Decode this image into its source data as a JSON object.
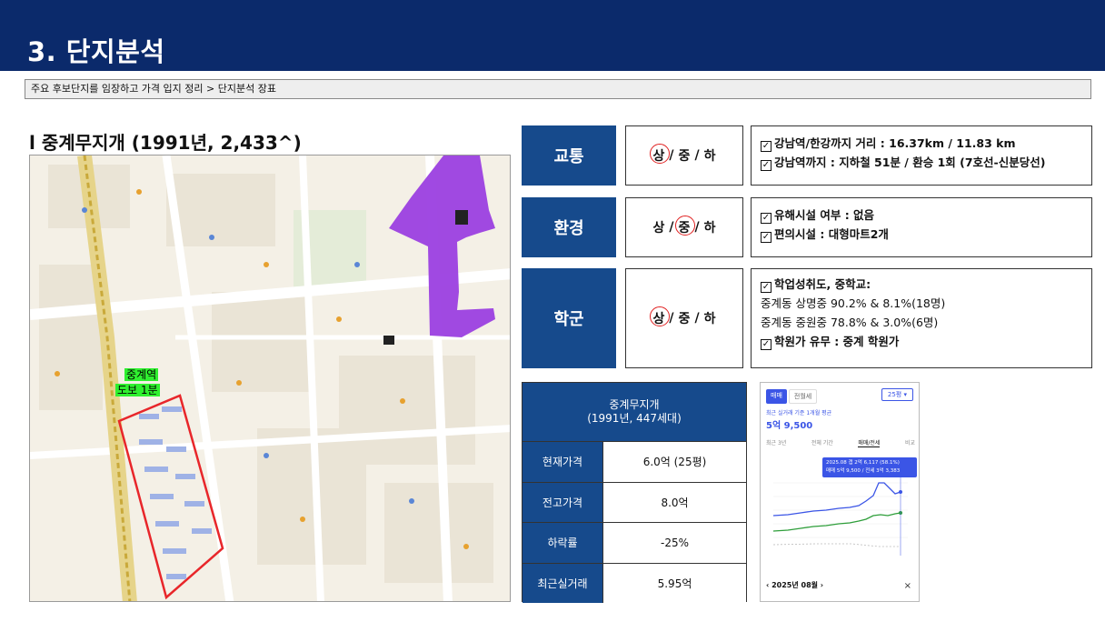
{
  "header": {
    "title": "3. 단지분석"
  },
  "breadcrumb": "주요 후보단지를 임장하고 가격 입지 정리 > 단지분석 장표",
  "complex": {
    "title": "l 중계무지개 (1991년, 2,433^)"
  },
  "map": {
    "station_label_1": "중계역",
    "station_label_2": "도보 1분",
    "colors": {
      "complex_outline": "#e8262a",
      "zone_fill": "#9b3fe0",
      "rail": "#d4b84a"
    }
  },
  "criteria": [
    {
      "category": "교통",
      "grades": [
        "상",
        "중",
        "하"
      ],
      "selected": 0,
      "details": [
        {
          "text": "강남역/한강까지 거리 : 16.37km / 11.83 km",
          "checked": true
        },
        {
          "text": "강남역까지 : 지하철 51분 / 환승 1회 (7호선-신분당선)",
          "checked": true
        }
      ]
    },
    {
      "category": "환경",
      "grades": [
        "상",
        "중",
        "하"
      ],
      "selected": 1,
      "details": [
        {
          "text": "유해시설 여부 : 없음",
          "checked": true
        },
        {
          "text": "편의시설 : 대형마트2개",
          "checked": true
        }
      ]
    },
    {
      "category": "학군",
      "grades": [
        "상",
        "중",
        "하"
      ],
      "selected": 0,
      "details": [
        {
          "text": "학업성취도, 중학교:",
          "checked": true
        },
        {
          "text": "중계동 상명중 90.2% & 8.1%(18명)",
          "checked": false
        },
        {
          "text": "중계동 중원중 78.8% & 3.0%(6명)",
          "checked": false
        },
        {
          "text": "학원가 유무 : 중계 학원가",
          "checked": true
        }
      ]
    }
  ],
  "price_table": {
    "title_line1": "중계무지개",
    "title_line2": "(1991년, 447세대)",
    "rows": [
      {
        "label": "현재가격",
        "value": "6.0억  (25평)"
      },
      {
        "label": "전고가격",
        "value": "8.0억"
      },
      {
        "label": "하락률",
        "value": "-25%"
      },
      {
        "label": "최근실거래",
        "value": "5.95억"
      }
    ]
  },
  "price_widget": {
    "tab_sale": "매매",
    "tab_jeonse": "전월세",
    "size": "25평",
    "caption": "최근 실거래 기준 1개월 평균",
    "price": "5억 9,500",
    "periods": [
      "최근 3년",
      "전체 기간",
      "매매/전세",
      "비교"
    ],
    "active_period": 2,
    "tooltip_line1": "2025.08  갭 2억 6,117 (58.1%)",
    "tooltip_line2": "매매 5억 9,500 / 전세 3억 3,383",
    "footer_date": "2025년 08월",
    "close": "×",
    "colors": {
      "sale": "#3b55e6",
      "jeonse": "#2e9e3a"
    }
  }
}
